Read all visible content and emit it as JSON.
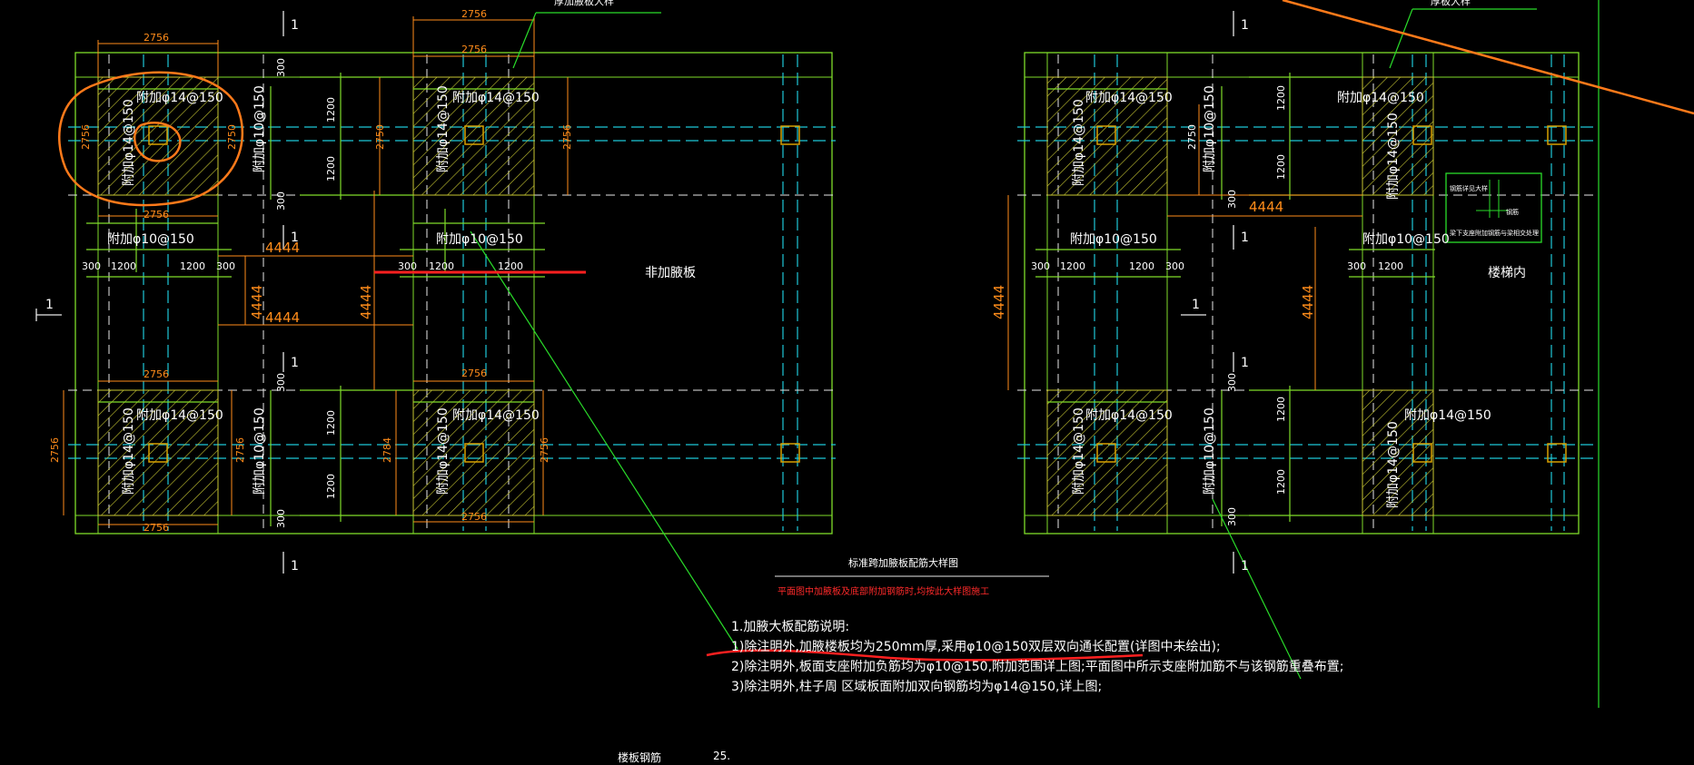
{
  "colors": {
    "background": "#000000",
    "outline": "#7fdc2a",
    "axis_cyan": "#1ec8d8",
    "axis_white": "#e8e8e8",
    "dim_orange": "#ff8c1a",
    "hatch_yellow": "#c8c832",
    "text_white": "#ffffff",
    "markup_red": "#ff2020",
    "markup_orange": "#ff7a1a"
  },
  "labels": {
    "dim_2756": "2756",
    "dim_4444": "4444",
    "dim_1200": "1200",
    "dim_300": "300",
    "dim_2784": "2784",
    "dim_2750": "2750",
    "rebar_14": "附加φ14@150",
    "rebar_10": "附加φ10@150",
    "section_1": "1",
    "no_thicken": "非加腋板",
    "stair_inner": "楼梯内",
    "thick_slab_left": "厚加腋板大样",
    "thick_slab_right": "厚板大样",
    "detail_box_top": "钢筋详见大样",
    "detail_box_mid": "钢筋",
    "detail_box_bottom": "梁下支座附加钢筋与梁相交处理"
  },
  "plan": {
    "title": "标准跨加腋板配筋大样图",
    "subtitle": "平面图中加腋板及底部附加钢筋时,均按此大样图施工"
  },
  "notes": [
    "1.加腋大板配筋说明:",
    "  1)除注明外,加腋楼板均为250mm厚,采用φ10@150双层双向通长配置(详图中未绘出);",
    "  2)除注明外,板面支座附加负筋均为φ10@150,附加范围详上图;平面图中所示支座附加筋不与该钢筋重叠布置;",
    "  3)除注明外,柱子周     区域板面附加双向钢筋均为φ14@150,详上图;"
  ],
  "bottom": {
    "label": "楼板钢筋",
    "label2": "25."
  }
}
